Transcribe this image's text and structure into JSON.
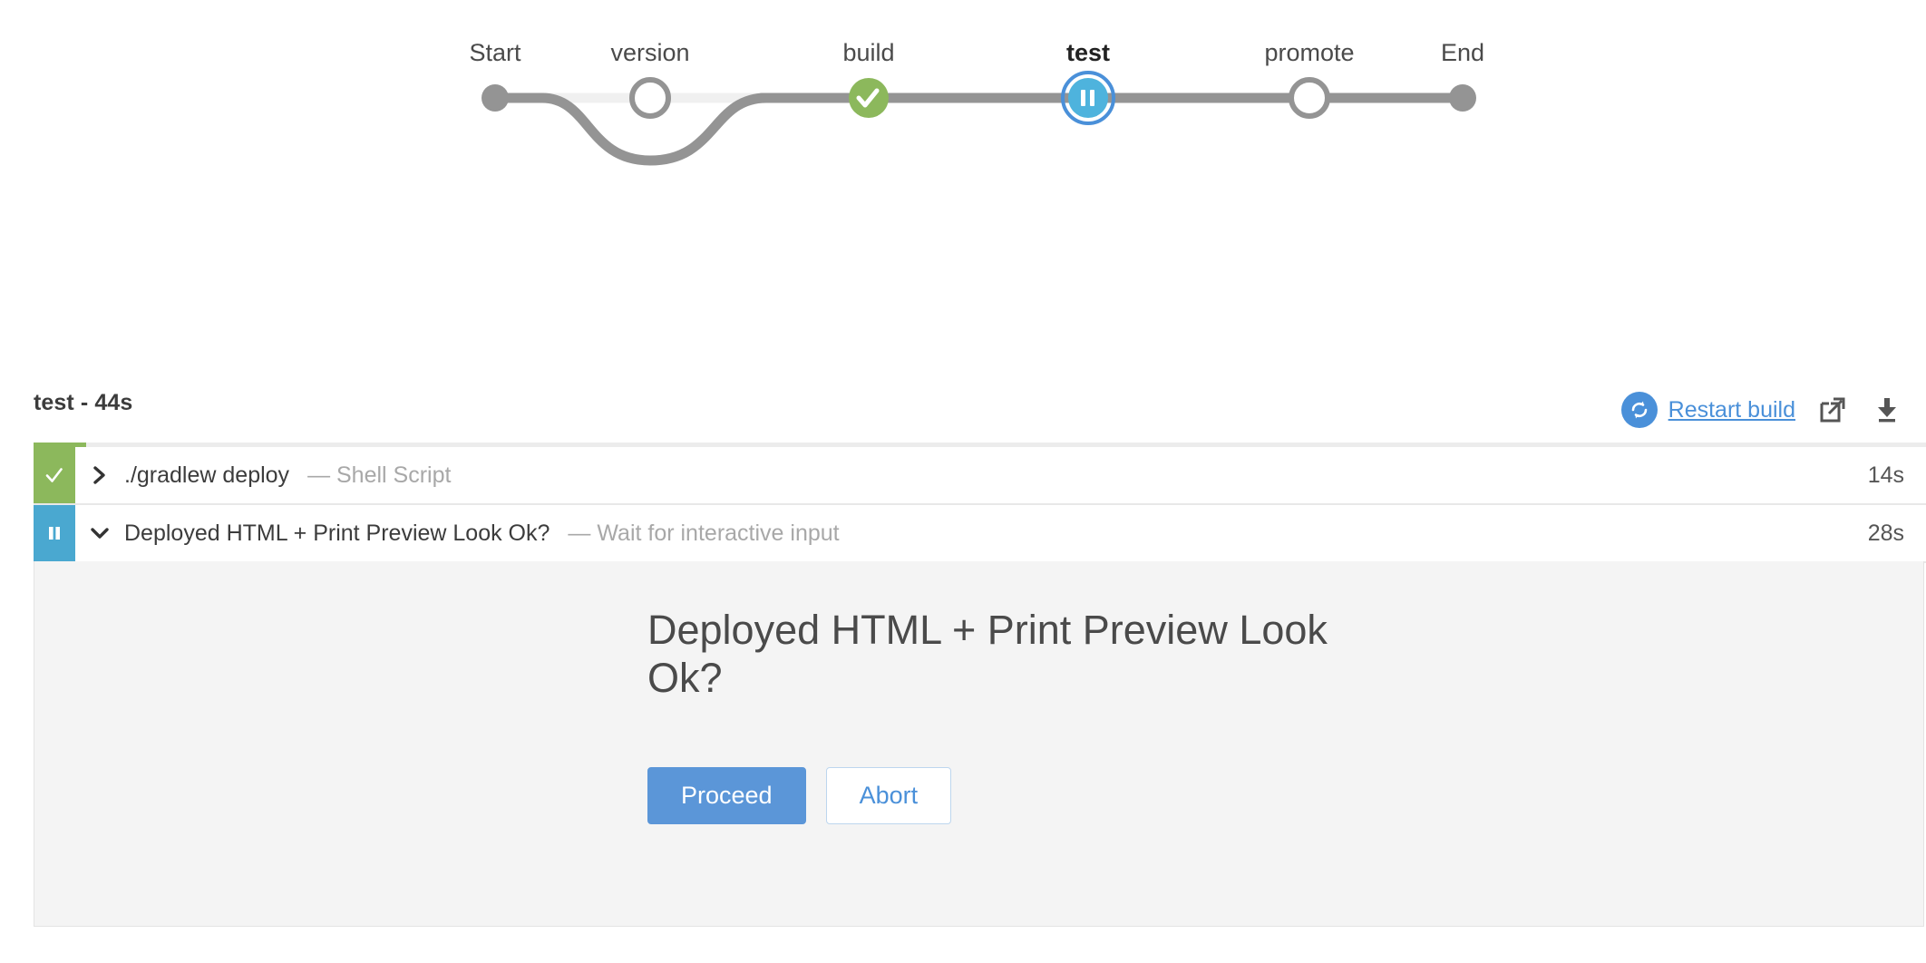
{
  "pipeline": {
    "stages": [
      {
        "label": "Start",
        "type": "endpoint",
        "state": "done",
        "current": false
      },
      {
        "label": "version",
        "type": "node",
        "state": "skipped",
        "current": false
      },
      {
        "label": "build",
        "type": "node",
        "state": "success",
        "current": false
      },
      {
        "label": "test",
        "type": "node",
        "state": "paused",
        "current": true
      },
      {
        "label": "promote",
        "type": "node",
        "state": "pending",
        "current": false
      },
      {
        "label": "End",
        "type": "endpoint",
        "state": "pending",
        "current": false
      }
    ],
    "colors": {
      "edge": "#949494",
      "edge_muted": "#f0f0f0",
      "success": "#8cb85c",
      "paused_fill": "#4eb3dd",
      "paused_ring": "#4a90d9",
      "pending": "#949494"
    }
  },
  "header": {
    "title": "test - 44s",
    "restart_label": "Restart build",
    "restart_icon": "restart-circle-icon",
    "open_icon": "external-link-icon",
    "download_icon": "download-icon",
    "progress_percent": 2.8,
    "progress_color": "#8cb85c"
  },
  "steps": [
    {
      "status": "success",
      "status_icon": "check-icon",
      "chevron": "chevron-right-icon",
      "expanded": false,
      "name": "./gradlew deploy",
      "type": "— Shell Script",
      "duration": "14s"
    },
    {
      "status": "paused",
      "status_icon": "pause-icon",
      "chevron": "chevron-down-icon",
      "expanded": true,
      "name": "Deployed HTML + Print Preview Look Ok?",
      "type": "— Wait for interactive input",
      "duration": "28s"
    }
  ],
  "input_panel": {
    "question": "Deployed HTML + Print Preview Look Ok?",
    "proceed_label": "Proceed",
    "abort_label": "Abort",
    "proceed_color": "#5b96d8",
    "abort_color": "#4a90d9"
  }
}
